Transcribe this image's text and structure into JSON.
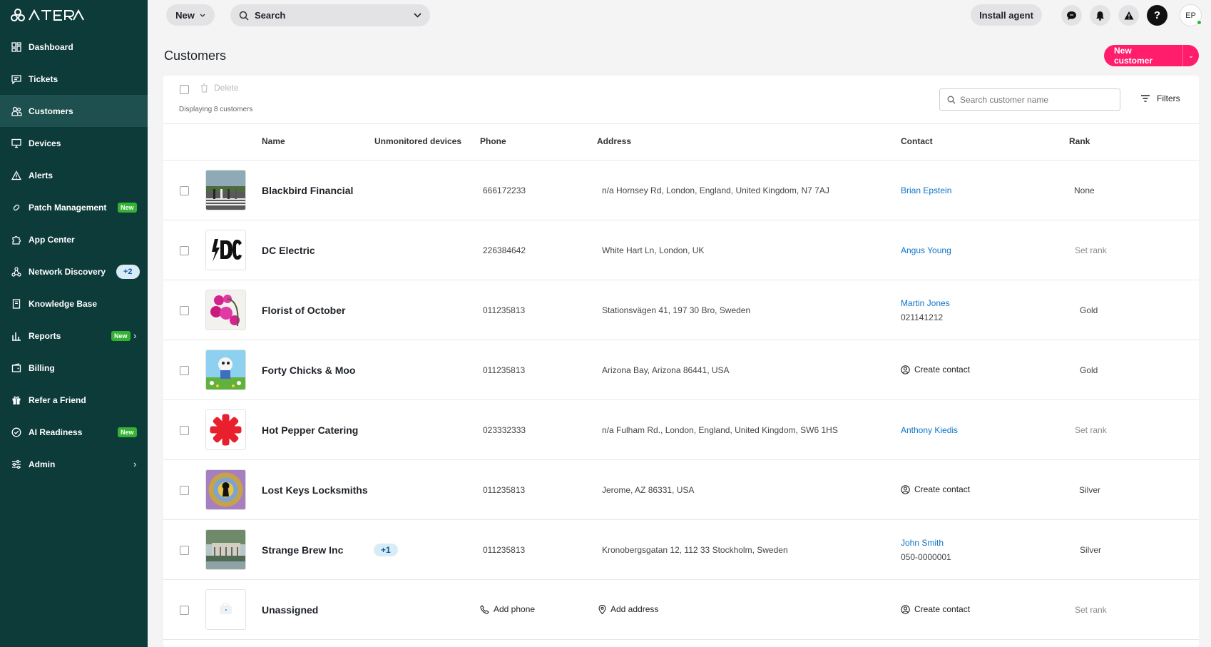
{
  "app": {
    "logo_text": "ATERA"
  },
  "sidebar": {
    "items": [
      {
        "label": "Dashboard",
        "icon": "dashboard-icon"
      },
      {
        "label": "Tickets",
        "icon": "ticket-icon"
      },
      {
        "label": "Customers",
        "icon": "customers-icon",
        "active": true
      },
      {
        "label": "Devices",
        "icon": "monitor-icon"
      },
      {
        "label": "Alerts",
        "icon": "alert-icon"
      },
      {
        "label": "Patch Management",
        "icon": "patch-icon",
        "badge": "New"
      },
      {
        "label": "App Center",
        "icon": "puzzle-icon"
      },
      {
        "label": "Network Discovery",
        "icon": "network-icon",
        "count": "+2"
      },
      {
        "label": "Knowledge Base",
        "icon": "book-icon"
      },
      {
        "label": "Reports",
        "icon": "chart-icon",
        "badge": "New",
        "chevron": true
      },
      {
        "label": "Billing",
        "icon": "billing-icon"
      },
      {
        "label": "Refer a Friend",
        "icon": "gift-icon"
      },
      {
        "label": "AI Readiness",
        "icon": "check-circle-icon",
        "badge": "New"
      },
      {
        "label": "Admin",
        "icon": "sliders-icon",
        "chevron": true
      }
    ]
  },
  "topbar": {
    "new_label": "New",
    "search_label": "Search",
    "install_label": "Install agent",
    "avatar_initials": "EP",
    "help_glyph": "?"
  },
  "page": {
    "title": "Customers",
    "new_customer_label": "New customer"
  },
  "toolbar": {
    "delete_label": "Delete",
    "displaying_text": "Displaying 8 customers",
    "search_placeholder": "Search customer name",
    "filters_label": "Filters"
  },
  "table": {
    "headers": {
      "name": "Name",
      "unmonitored": "Unmonitored devices",
      "phone": "Phone",
      "address": "Address",
      "contact": "Contact",
      "rank": "Rank"
    },
    "create_contact_label": "Create contact",
    "add_phone_label": "Add phone",
    "add_address_label": "Add address",
    "rows": [
      {
        "name": "Blackbird Financial",
        "unmonitored": "",
        "phone": "666172233",
        "address": "n/a Hornsey Rd, London, England, United Kingdom, N7 7AJ",
        "contact": "Brian Epstein",
        "contact_phone": "",
        "rank": "None"
      },
      {
        "name": "DC Electric",
        "unmonitored": "",
        "phone": "226384642",
        "address": "White Hart Ln, London, UK",
        "contact": "Angus Young",
        "contact_phone": "",
        "rank": "Set rank"
      },
      {
        "name": "Florist of October",
        "unmonitored": "",
        "phone": "011235813",
        "address": "Stationsvägen 41, 197 30 Bro, Sweden",
        "contact": "Martin Jones",
        "contact_phone": "021141212",
        "rank": "Gold"
      },
      {
        "name": "Forty Chicks & Moo",
        "unmonitored": "",
        "phone": "011235813",
        "address": "Arizona Bay, Arizona 86441, USA",
        "contact": "",
        "contact_phone": "",
        "rank": "Gold"
      },
      {
        "name": "Hot Pepper Catering",
        "unmonitored": "",
        "phone": "023332333",
        "address": "n/a Fulham Rd., London, England, United Kingdom, SW6 1HS",
        "contact": "Anthony Kiedis",
        "contact_phone": "",
        "rank": "Set rank"
      },
      {
        "name": "Lost Keys Locksmiths",
        "unmonitored": "",
        "phone": "011235813",
        "address": "Jerome, AZ 86331, USA",
        "contact": "",
        "contact_phone": "",
        "rank": "Silver"
      },
      {
        "name": "Strange Brew Inc",
        "unmonitored": "+1",
        "phone": "011235813",
        "address": "Kronobergsgatan 12, 112 33 Stockholm, Sweden",
        "contact": "John Smith",
        "contact_phone": "050-0000001",
        "rank": "Silver"
      },
      {
        "name": "Unassigned",
        "unmonitored": "",
        "phone": "",
        "address": "",
        "contact": "",
        "contact_phone": "",
        "rank": "Set rank"
      }
    ]
  },
  "colors": {
    "sidebar_bg": "#0d3b3a",
    "accent_pink": "#ff1d6c",
    "link_blue": "#0d74c7",
    "badge_green": "#34b233"
  }
}
